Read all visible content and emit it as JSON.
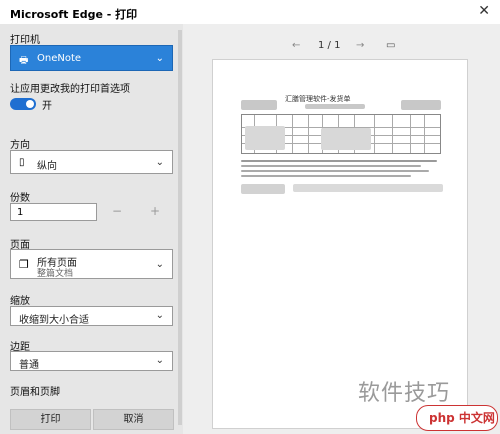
{
  "window": {
    "title": "Microsoft Edge - 打印"
  },
  "printer": {
    "label": "打印机",
    "value": "OneNote"
  },
  "app_choose": {
    "label": "让应用更改我的打印首选项",
    "toggle_text": "开",
    "on": true
  },
  "orientation": {
    "label": "方向",
    "value": "纵向"
  },
  "copies": {
    "label": "份数",
    "value": "1",
    "minus": "−",
    "plus": "+"
  },
  "pages": {
    "label": "页面",
    "value": "所有页面",
    "sub": "整篇文档"
  },
  "scale": {
    "label": "缩放",
    "value": "收缩到大小合适"
  },
  "margins": {
    "label": "边距",
    "value": "普通"
  },
  "header_footer": {
    "label": "页眉和页脚"
  },
  "actions": {
    "print": "打印",
    "cancel": "取消"
  },
  "preview": {
    "page_indicator": "1 / 1",
    "doc_title": "汇膳管理软件-发货单"
  },
  "watermark": {
    "text": "软件技巧",
    "logo_text": "php 中文网"
  }
}
